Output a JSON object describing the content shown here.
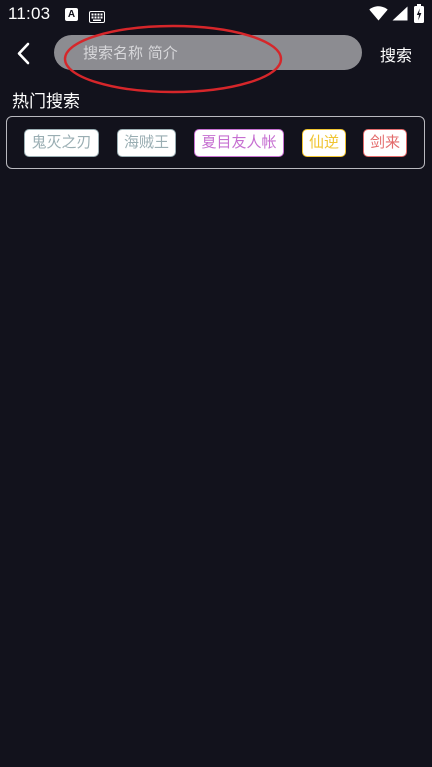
{
  "status_bar": {
    "time": "11:03",
    "icons": [
      "a-icon",
      "keyboard-icon",
      "wifi-icon",
      "signal-icon",
      "battery-icon"
    ]
  },
  "top_bar": {
    "search_placeholder": "搜索名称 简介",
    "search_value": "",
    "search_button_label": "搜索"
  },
  "annotation": {
    "color": "#d6262a"
  },
  "hot_search": {
    "title": "热门搜索",
    "tags": [
      {
        "label": "鬼灭之刃",
        "color": "#9aaeb3"
      },
      {
        "label": "海贼王",
        "color": "#9aaeb3"
      },
      {
        "label": "夏目友人帐",
        "color": "#c66fd1"
      },
      {
        "label": "仙逆",
        "color": "#f0c430"
      },
      {
        "label": "剑来",
        "color": "#e36b6b"
      }
    ]
  }
}
